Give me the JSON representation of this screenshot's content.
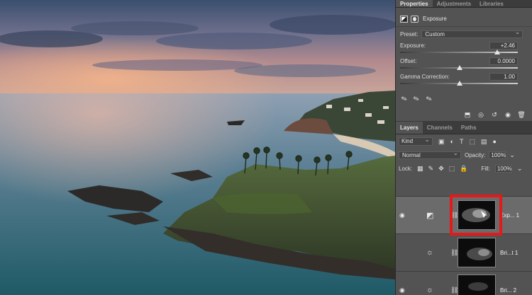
{
  "panel_tabs": [
    {
      "label": "Properties"
    },
    {
      "label": "Adjustments"
    },
    {
      "label": "Libraries"
    }
  ],
  "properties": {
    "title": "Exposure",
    "preset_label": "Preset:",
    "preset_value": "Custom",
    "exposure_label": "Exposure:",
    "exposure_value": "+2.46",
    "exposure_fraction": 0.82,
    "offset_label": "Offset:",
    "offset_value": "0.0000",
    "offset_fraction": 0.5,
    "gamma_label": "Gamma Correction:",
    "gamma_value": "1.00",
    "gamma_fraction": 0.5
  },
  "layers_tabs": [
    {
      "label": "Layers"
    },
    {
      "label": "Channels"
    },
    {
      "label": "Paths"
    }
  ],
  "layers_panel": {
    "filter_kind": "Kind",
    "blend_mode": "Normal",
    "opacity_label": "Opacity:",
    "opacity_value": "100%",
    "lock_label": "Lock:",
    "fill_label": "Fill:",
    "fill_value": "100%"
  },
  "layers": [
    {
      "name": "Exp... 1",
      "selected": true,
      "visible": true
    },
    {
      "name": "Bri...t 1",
      "selected": false,
      "visible": false
    },
    {
      "name": "Bri... 2",
      "selected": false,
      "visible": true
    }
  ],
  "colors": {
    "highlight": "#e41a1a",
    "panel_bg": "#535353",
    "selected_layer": "#6b6b6b"
  }
}
